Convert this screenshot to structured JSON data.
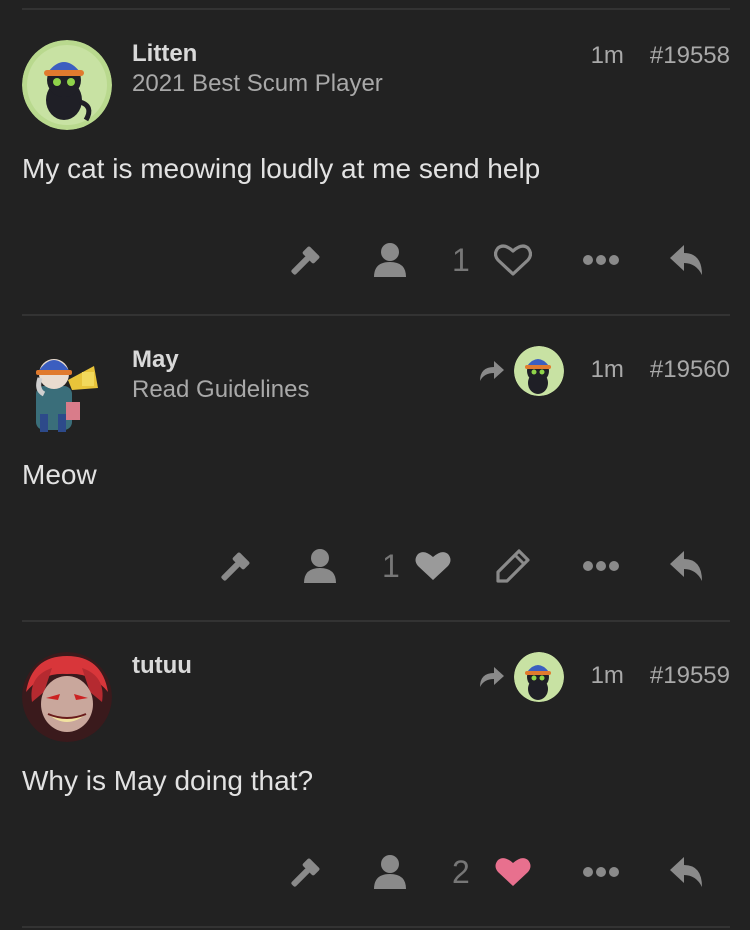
{
  "posts": [
    {
      "username": "Litten",
      "user_title": "2021 Best Scum Player",
      "time": "1m",
      "post_number": "#19558",
      "body": "My cat is meowing loudly at me send help",
      "like_count": "1",
      "liked": false,
      "reply_to": false,
      "can_edit": false
    },
    {
      "username": "May",
      "user_title": "Read Guidelines",
      "time": "1m",
      "post_number": "#19560",
      "body": "Meow",
      "like_count": "1",
      "liked": true,
      "reply_to": true,
      "can_edit": true
    },
    {
      "username": "tutuu",
      "user_title": "",
      "time": "1m",
      "post_number": "#19559",
      "body": "Why is May doing that?",
      "like_count": "2",
      "liked": true,
      "reply_to": true,
      "can_edit": false
    }
  ],
  "icons": {
    "admin": "gavel-icon",
    "user": "user-icon",
    "like": "heart-icon",
    "edit": "pencil-icon",
    "more": "ellipsis-icon",
    "reply": "reply-icon",
    "reply_to": "share-arrow-icon"
  },
  "colors": {
    "background": "#222222",
    "icon": "#8a8a8a",
    "liked_gray": "#9a9a9a",
    "liked_pink": "#e8708e"
  }
}
